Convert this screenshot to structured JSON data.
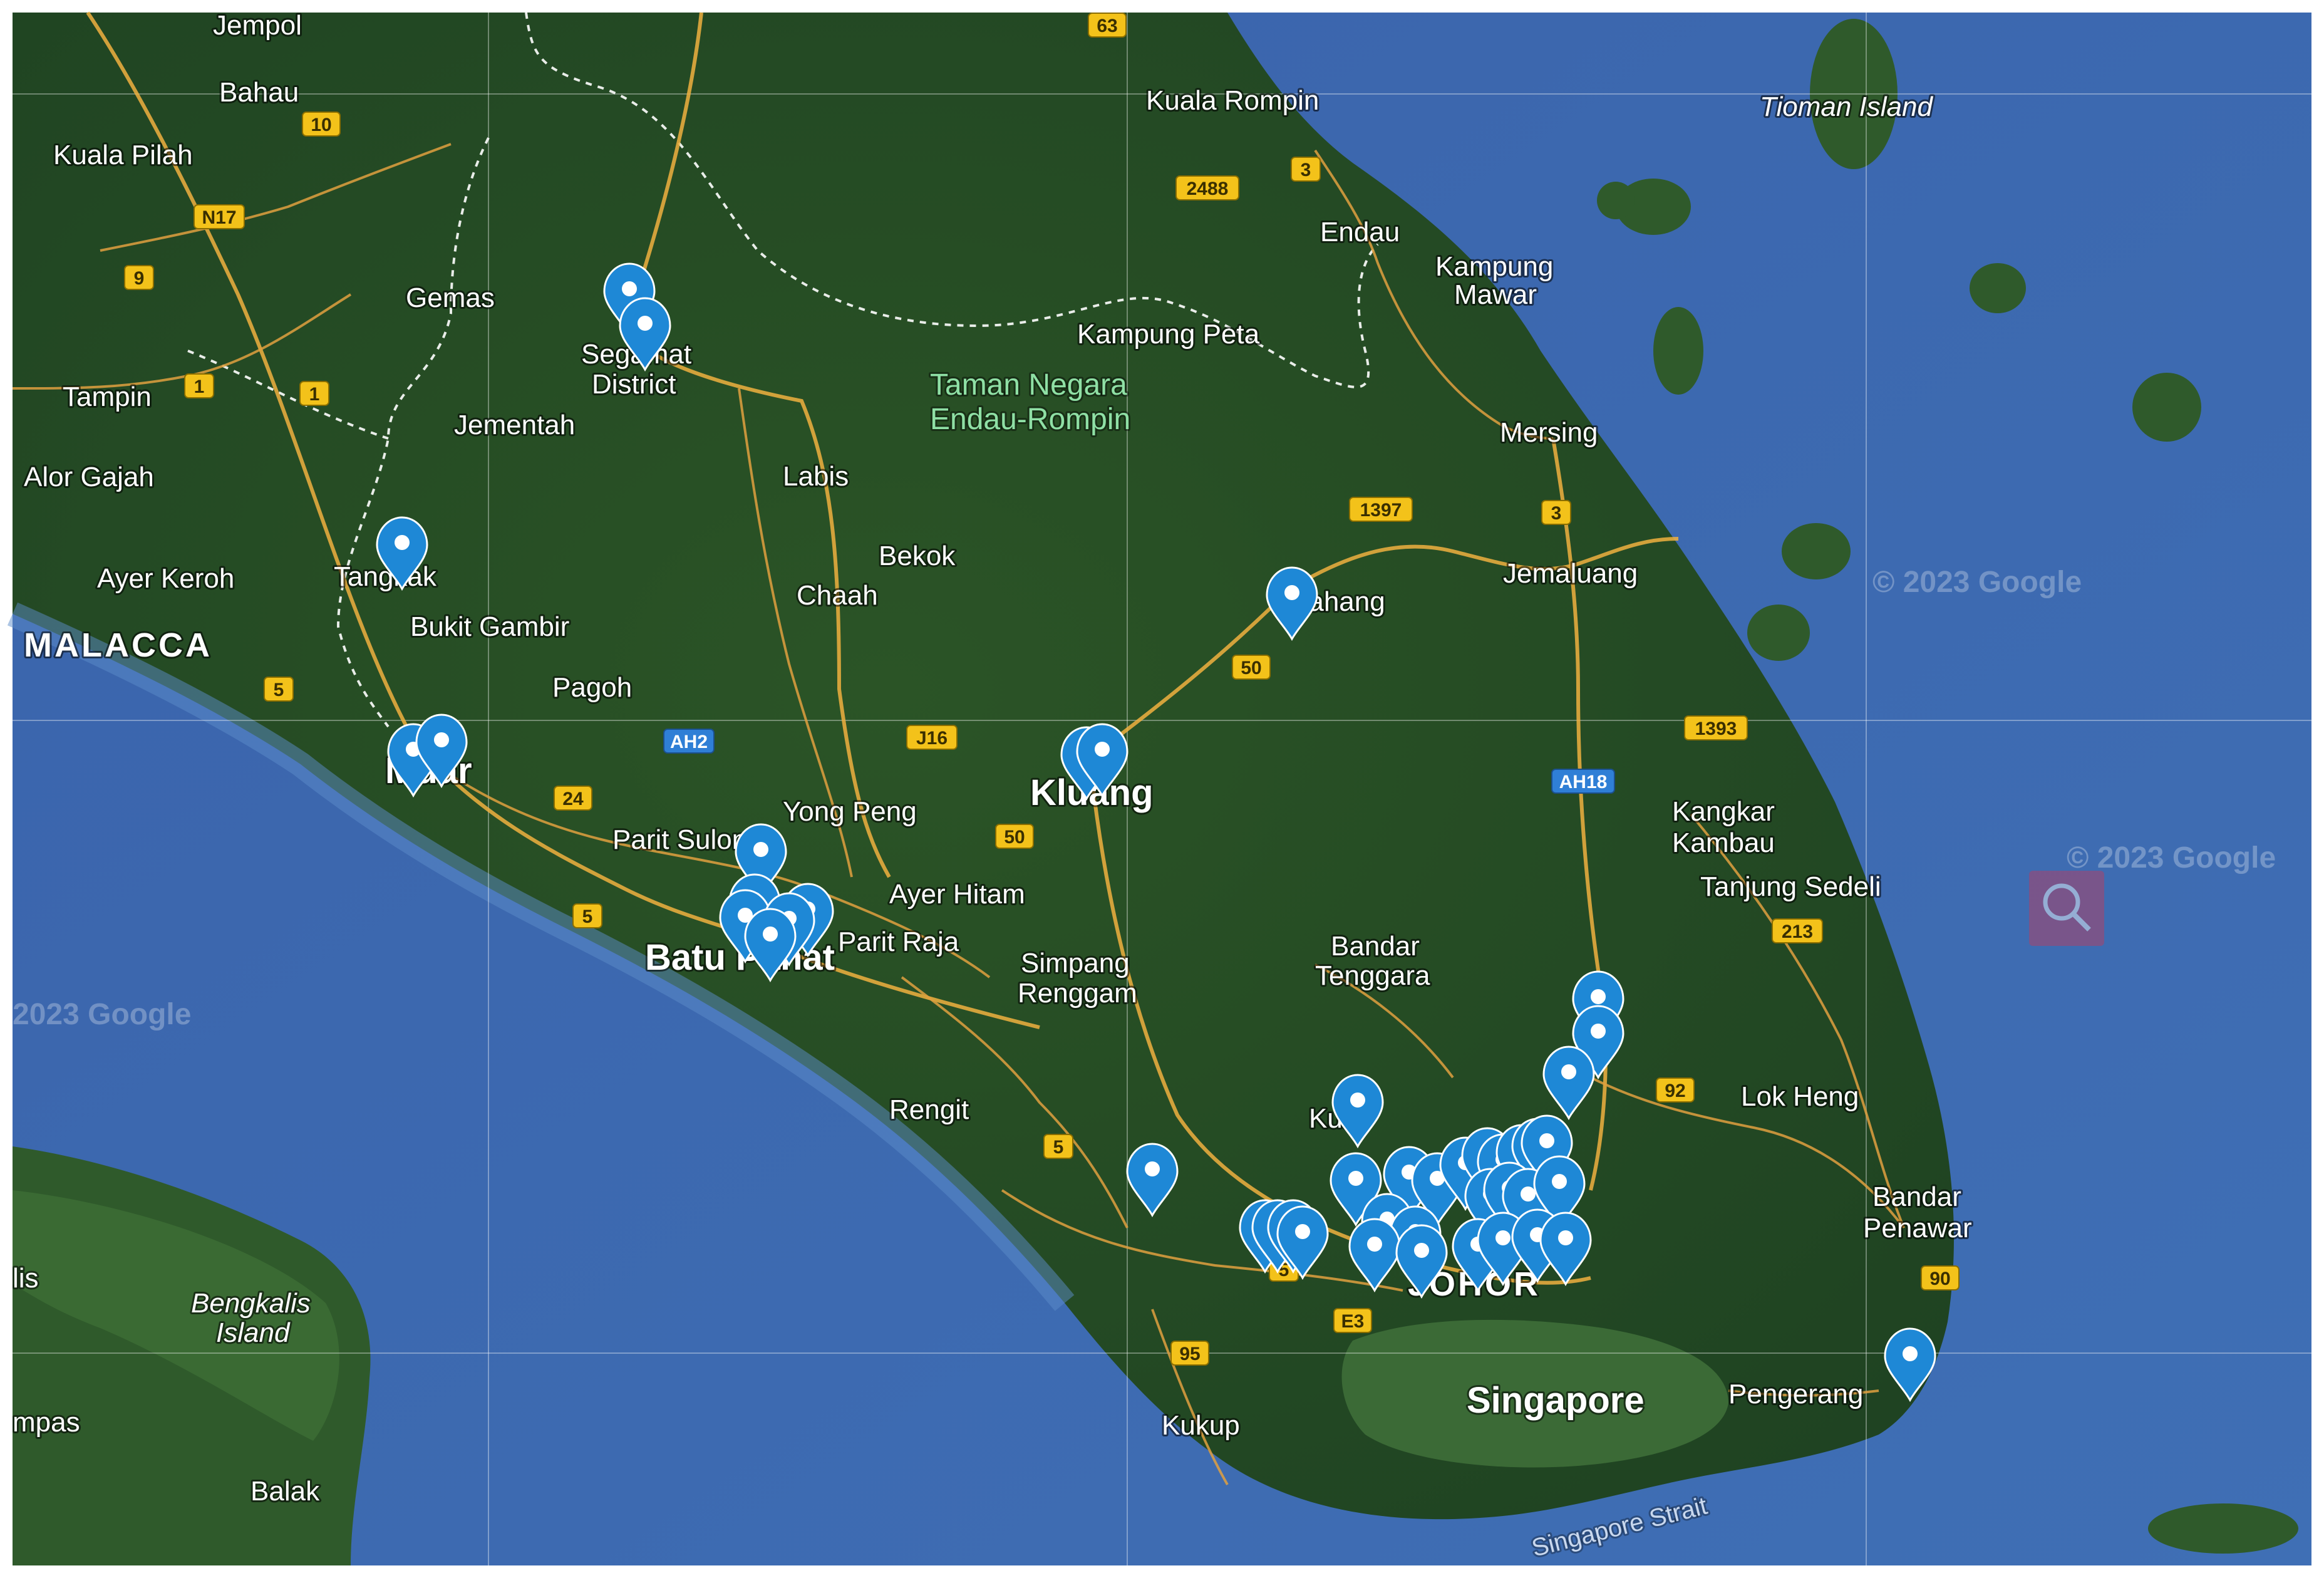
{
  "watermark": "© 2023 Google",
  "watermarks": [
    {
      "text": "© 2023 Google"
    },
    {
      "text": "© 2023 Google"
    },
    {
      "text": "2023 Google"
    }
  ],
  "colors": {
    "sea": "#3d66ad",
    "sea_shallow": "#4b78b8",
    "land": "#2e5a2a",
    "land_dark": "#1f4322",
    "marker": "#1e88d6",
    "route_shield": "#f3c21a",
    "asian_highway_shield": "#2f7fd6"
  },
  "places": [
    {
      "name": "Jempol",
      "class": "place"
    },
    {
      "name": "Bahau",
      "class": "place"
    },
    {
      "name": "Kuala Pilah",
      "class": "place"
    },
    {
      "name": "Gemas",
      "class": "place"
    },
    {
      "name": "Tampin",
      "class": "place"
    },
    {
      "name": "Jementah",
      "class": "place"
    },
    {
      "name": "Alor Gajah",
      "class": "place"
    },
    {
      "name": "Ayer Keroh",
      "class": "place"
    },
    {
      "name": "Tangkak",
      "class": "place"
    },
    {
      "name": "MALACCA",
      "class": "place state"
    },
    {
      "name": "Bukit Gambir",
      "class": "place"
    },
    {
      "name": "Pagoh",
      "class": "place"
    },
    {
      "name": "Muar",
      "class": "place major"
    },
    {
      "name": "Segamat",
      "class": "place"
    },
    {
      "name": "District",
      "class": "place"
    },
    {
      "name": "Labis",
      "class": "place"
    },
    {
      "name": "Bekok",
      "class": "place"
    },
    {
      "name": "Chaah",
      "class": "place"
    },
    {
      "name": "Yong Peng",
      "class": "place"
    },
    {
      "name": "Parit Sulong",
      "class": "place"
    },
    {
      "name": "Batu Pahat",
      "class": "place major"
    },
    {
      "name": "Parit Raja",
      "class": "place"
    },
    {
      "name": "Ayer Hitam",
      "class": "place"
    },
    {
      "name": "Kluang",
      "class": "place major"
    },
    {
      "name": "Simpang",
      "class": "place"
    },
    {
      "name": "Renggam",
      "class": "place"
    },
    {
      "name": "Rengit",
      "class": "place"
    },
    {
      "name": "Kuala Rompin",
      "class": "place"
    },
    {
      "name": "Endau",
      "class": "place"
    },
    {
      "name": "Kampung",
      "class": "place"
    },
    {
      "name": "Mawar",
      "class": "place"
    },
    {
      "name": "Kampung Peta",
      "class": "place"
    },
    {
      "name": "Taman Negara",
      "class": "place park"
    },
    {
      "name": "Endau-Rompin",
      "class": "place park"
    },
    {
      "name": "Mersing",
      "class": "place"
    },
    {
      "name": "Jemaluang",
      "class": "place"
    },
    {
      "name": "Kahang",
      "class": "place"
    },
    {
      "name": "Kangkar",
      "class": "place"
    },
    {
      "name": "Kambau",
      "class": "place"
    },
    {
      "name": "Tanjung Sedeli",
      "class": "place"
    },
    {
      "name": "Bandar",
      "class": "place"
    },
    {
      "name": "Tenggara",
      "class": "place"
    },
    {
      "name": "Lok Heng",
      "class": "place"
    },
    {
      "name": "Kulai",
      "class": "place"
    },
    {
      "name": "Bandar",
      "class": "place"
    },
    {
      "name": "Penawar",
      "class": "place"
    },
    {
      "name": "JOHOR",
      "class": "place state"
    },
    {
      "name": "Singapore",
      "class": "place major"
    },
    {
      "name": "Pengerang",
      "class": "place"
    },
    {
      "name": "Kukup",
      "class": "place"
    },
    {
      "name": "Tioman Island",
      "class": "place island"
    },
    {
      "name": "Bengkalis",
      "class": "place island"
    },
    {
      "name": "Island",
      "class": "place island"
    },
    {
      "name": "Balak",
      "class": "place"
    },
    {
      "name": "lis",
      "class": "place"
    },
    {
      "name": "mpas",
      "class": "place"
    },
    {
      "name": "Singapore Strait",
      "class": "place water"
    }
  ],
  "shields": [
    {
      "text": "63",
      "type": "yellow"
    },
    {
      "text": "10",
      "type": "yellow"
    },
    {
      "text": "N17",
      "type": "yellow"
    },
    {
      "text": "9",
      "type": "yellow"
    },
    {
      "text": "1",
      "type": "yellow"
    },
    {
      "text": "1",
      "type": "yellow"
    },
    {
      "text": "5",
      "type": "yellow"
    },
    {
      "text": "AH2",
      "type": "blue"
    },
    {
      "text": "J16",
      "type": "yellow"
    },
    {
      "text": "24",
      "type": "yellow"
    },
    {
      "text": "5",
      "type": "yellow"
    },
    {
      "text": "50",
      "type": "yellow"
    },
    {
      "text": "50",
      "type": "yellow"
    },
    {
      "text": "2488",
      "type": "yellow"
    },
    {
      "text": "3",
      "type": "yellow"
    },
    {
      "text": "1397",
      "type": "yellow"
    },
    {
      "text": "3",
      "type": "yellow"
    },
    {
      "text": "1393",
      "type": "yellow"
    },
    {
      "text": "AH18",
      "type": "blue"
    },
    {
      "text": "213",
      "type": "yellow"
    },
    {
      "text": "92",
      "type": "yellow"
    },
    {
      "text": "90",
      "type": "yellow"
    },
    {
      "text": "5",
      "type": "yellow"
    },
    {
      "text": "5",
      "type": "yellow"
    },
    {
      "text": "E3",
      "type": "yellow"
    },
    {
      "text": "95",
      "type": "yellow"
    }
  ],
  "markers_count": 44
}
